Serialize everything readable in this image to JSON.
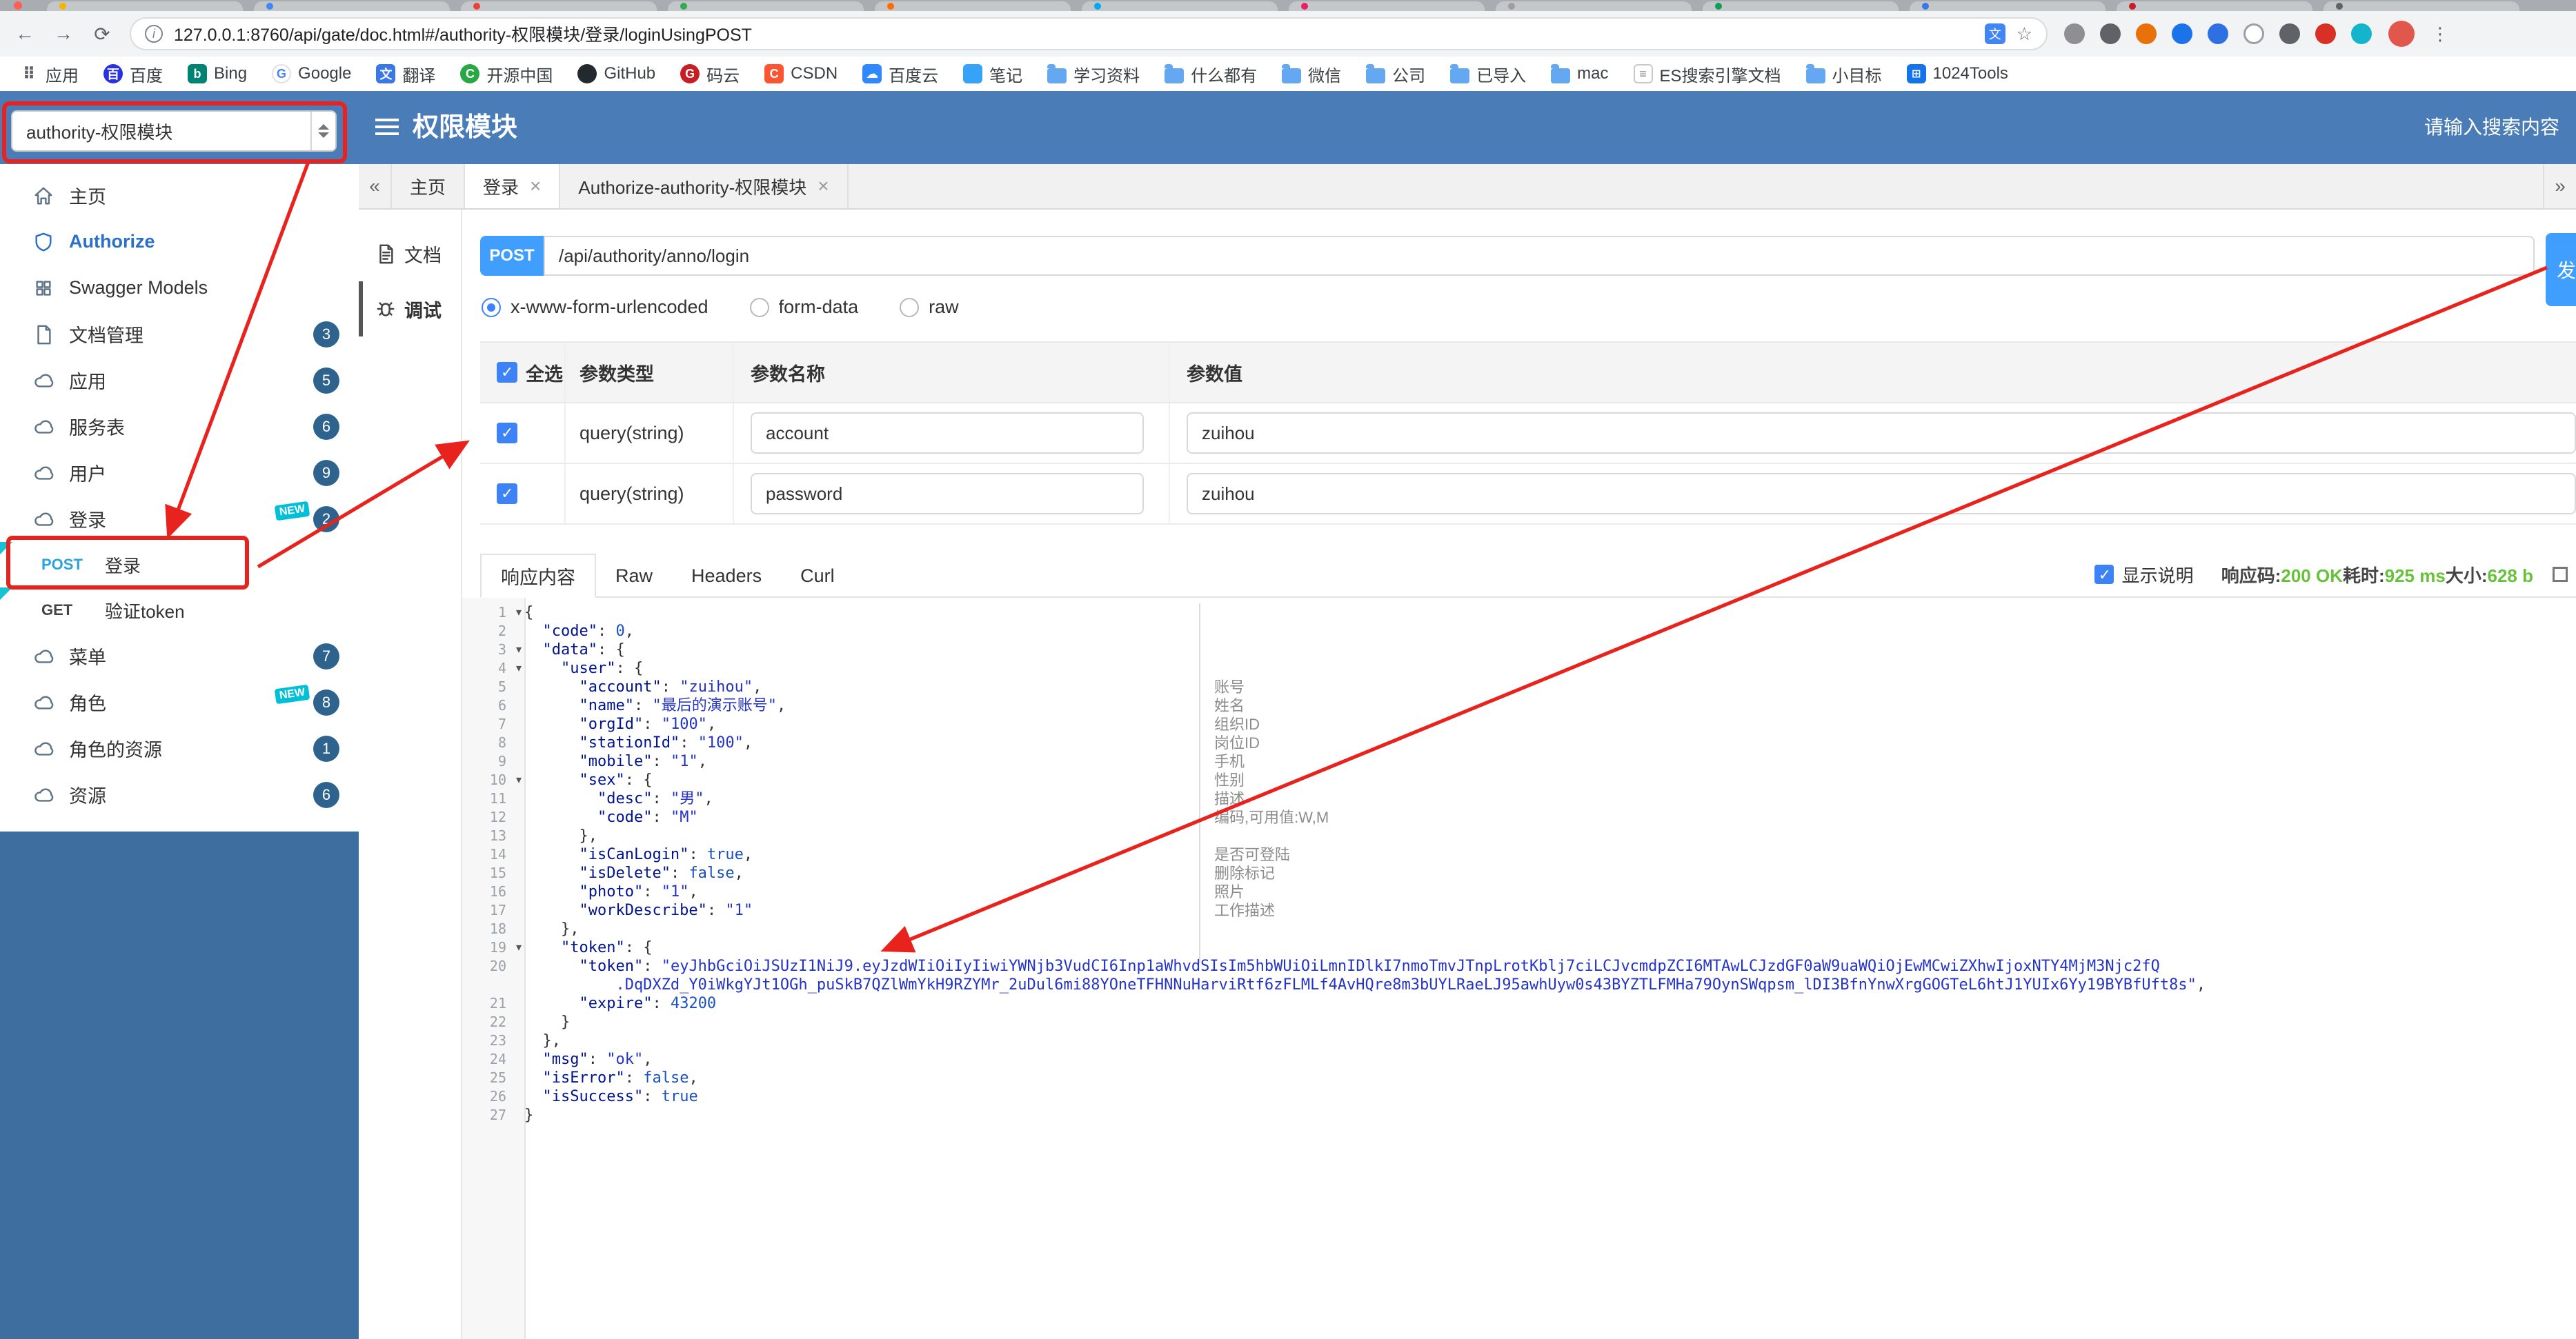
{
  "accent": {
    "primary_blue": "#409EFF",
    "header_blue": "#4a7cb8",
    "sidebar_fill_blue": "#3d6e9f",
    "annotation_red": "#e8231d",
    "badge_blue": "#2e638e",
    "new_teal": "#00c0d8",
    "success_green": "#67c23a"
  },
  "browser": {
    "traffic_light_red": "#ff5f57",
    "tab_favicons": [
      "#f4b400",
      "#4285f4",
      "#ea4335",
      "#34a853",
      "#ff6d00",
      "#03a9f4",
      "#e91e63",
      "#9e9e9e",
      "#0f9d58",
      "#3b78e7",
      "#c71d23",
      "#5f6368"
    ],
    "back_icon": "←",
    "forward_icon": "→",
    "reload_icon": "⟳",
    "info_icon": "i",
    "url": "127.0.0.1:8760/api/gate/doc.html#/authority-权限模块/登录/loginUsingPOST",
    "translate_icon": "文",
    "star_icon": "☆",
    "menu_icon": "⋮",
    "avatar_color": "#e2574c",
    "extensions": [
      {
        "name": "panel-extension-icon",
        "color": "#8e8e93"
      },
      {
        "name": "grid-extension-icon",
        "color": "#5f6368"
      },
      {
        "name": "orange-extension-icon",
        "color": "#e8710a"
      },
      {
        "name": "blue-extension-icon",
        "color": "#1a73e8"
      },
      {
        "name": "json-extension-icon",
        "color": "#2f6fe4"
      },
      {
        "name": "ring-extension-icon",
        "color": "#ffffff"
      },
      {
        "name": "shield-extension-icon",
        "color": "#5f6368"
      },
      {
        "name": "red-extension-icon",
        "color": "#d93025"
      },
      {
        "name": "teal-extension-icon",
        "color": "#12b5cb"
      }
    ],
    "bookmarks": [
      {
        "label": "应用",
        "icon": "apps-grid-icon",
        "glyph": "⠿"
      },
      {
        "label": "百度",
        "icon": "baidu-icon",
        "glyph": "百"
      },
      {
        "label": "Bing",
        "icon": "bing-icon",
        "glyph": "b"
      },
      {
        "label": "Google",
        "icon": "google-icon",
        "glyph": "G"
      },
      {
        "label": "翻译",
        "icon": "translate-bookmark-icon",
        "glyph": "文"
      },
      {
        "label": "开源中国",
        "icon": "oschina-icon",
        "glyph": "C"
      },
      {
        "label": "GitHub",
        "icon": "github-icon",
        "glyph": ""
      },
      {
        "label": "码云",
        "icon": "gitee-icon",
        "glyph": "G"
      },
      {
        "label": "CSDN",
        "icon": "csdn-icon",
        "glyph": "C"
      },
      {
        "label": "百度云",
        "icon": "baidu-cloud-icon",
        "glyph": "☁"
      },
      {
        "label": "笔记",
        "icon": "note-icon",
        "glyph": ""
      },
      {
        "label": "学习资料",
        "icon": "folder-icon",
        "glyph": ""
      },
      {
        "label": "什么都有",
        "icon": "folder-icon",
        "glyph": ""
      },
      {
        "label": "微信",
        "icon": "folder-icon",
        "glyph": ""
      },
      {
        "label": "公司",
        "icon": "folder-icon",
        "glyph": ""
      },
      {
        "label": "已导入",
        "icon": "folder-icon",
        "glyph": ""
      },
      {
        "label": "mac",
        "icon": "folder-icon",
        "glyph": ""
      },
      {
        "label": "ES搜索引擎文档",
        "icon": "doc-icon",
        "glyph": "≡"
      },
      {
        "label": "小目标",
        "icon": "folder-icon",
        "glyph": ""
      },
      {
        "label": "1024Tools",
        "icon": "tools-icon",
        "glyph": "⊞"
      }
    ]
  },
  "header": {
    "module_select_value": "authority-权限模块",
    "title": "权限模块",
    "search_placeholder": "请输入搜索内容"
  },
  "sidebar": {
    "new_label": "NEW",
    "method_colors": {
      "POST": "#29a3dd",
      "GET": "#444444"
    },
    "items": [
      {
        "type": "item",
        "key": "home",
        "icon": "home",
        "label": "主页"
      },
      {
        "type": "item",
        "key": "authorize",
        "icon": "shield",
        "label": "Authorize",
        "accent": true
      },
      {
        "type": "item",
        "key": "swagger-models",
        "icon": "models",
        "label": "Swagger Models"
      },
      {
        "type": "item",
        "key": "doc-manage",
        "icon": "doc",
        "label": "文档管理",
        "badge": "3"
      },
      {
        "type": "item",
        "key": "application",
        "icon": "cloud",
        "label": "应用",
        "badge": "5"
      },
      {
        "type": "item",
        "key": "service-table",
        "icon": "cloud",
        "label": "服务表",
        "badge": "6"
      },
      {
        "type": "item",
        "key": "user",
        "icon": "cloud",
        "label": "用户",
        "badge": "9"
      },
      {
        "type": "item",
        "key": "login-group",
        "icon": "cloud",
        "label": "登录",
        "badge": "2",
        "new": true
      },
      {
        "type": "api",
        "key": "post-login",
        "method": "POST",
        "label": "登录",
        "boxed": true
      },
      {
        "type": "api",
        "key": "get-verify-token",
        "method": "GET",
        "label": "验证token"
      },
      {
        "type": "item",
        "key": "menu",
        "icon": "cloud",
        "label": "菜单",
        "badge": "7"
      },
      {
        "type": "item",
        "key": "role",
        "icon": "cloud",
        "label": "角色",
        "badge": "8",
        "new": true
      },
      {
        "type": "item",
        "key": "role-resource",
        "icon": "cloud",
        "label": "角色的资源",
        "badge": "1"
      },
      {
        "type": "item",
        "key": "resource",
        "icon": "cloud",
        "label": "资源",
        "badge": "6"
      }
    ]
  },
  "doc_tabs": {
    "left_chevron": "«",
    "right_chevron": "»",
    "close_icon": "×",
    "tabs": [
      {
        "key": "home",
        "label": "主页",
        "closable": false,
        "active": false
      },
      {
        "key": "login",
        "label": "登录",
        "closable": true,
        "active": true
      },
      {
        "key": "authorize-authority",
        "label": "Authorize-authority-权限模块",
        "closable": true,
        "active": false
      }
    ]
  },
  "doc_side": {
    "items": [
      {
        "key": "doc",
        "label": "文档",
        "icon": "document",
        "active": false
      },
      {
        "key": "debug",
        "label": "调试",
        "icon": "debug",
        "active": true
      }
    ]
  },
  "request": {
    "method": "POST",
    "url": "/api/authority/anno/login",
    "send_button_visible_text": "发",
    "content_types": [
      {
        "label": "x-www-form-urlencoded",
        "selected": true
      },
      {
        "label": "form-data",
        "selected": false
      },
      {
        "label": "raw",
        "selected": false
      }
    ]
  },
  "params_table": {
    "select_all_label": "全选",
    "headers": [
      "参数类型",
      "参数名称",
      "参数值"
    ],
    "rows": [
      {
        "checked": true,
        "type": "query(string)",
        "name": "account",
        "value": "zuihou"
      },
      {
        "checked": true,
        "type": "query(string)",
        "name": "password",
        "value": "zuihou"
      }
    ]
  },
  "response": {
    "tabs": [
      {
        "label": "响应内容",
        "active": true
      },
      {
        "label": "Raw",
        "active": false
      },
      {
        "label": "Headers",
        "active": false
      },
      {
        "label": "Curl",
        "active": false
      }
    ],
    "show_desc_label": "显示说明",
    "show_desc_checked": true,
    "meta": [
      {
        "label": "响应码:",
        "value": "200 OK"
      },
      {
        "label": "耗时:",
        "value": "925 ms"
      },
      {
        "label": "大小:",
        "value": "628 b"
      }
    ]
  },
  "code": {
    "fold_icon": "▾",
    "lines": [
      {
        "n": 1,
        "fold": true,
        "seg": [
          [
            "p",
            "{"
          ]
        ]
      },
      {
        "n": 2,
        "seg": [
          [
            "p",
            "  "
          ],
          [
            "k",
            "\"code\""
          ],
          [
            "p",
            ": "
          ],
          [
            "n",
            "0"
          ],
          [
            "p",
            ","
          ]
        ]
      },
      {
        "n": 3,
        "fold": true,
        "seg": [
          [
            "p",
            "  "
          ],
          [
            "k",
            "\"data\""
          ],
          [
            "p",
            ": {"
          ]
        ]
      },
      {
        "n": 4,
        "fold": true,
        "seg": [
          [
            "p",
            "    "
          ],
          [
            "k",
            "\"user\""
          ],
          [
            "p",
            ": {"
          ]
        ]
      },
      {
        "n": 5,
        "seg": [
          [
            "p",
            "      "
          ],
          [
            "k",
            "\"account\""
          ],
          [
            "p",
            ": "
          ],
          [
            "s",
            "\"zuihou\""
          ],
          [
            "p",
            ","
          ]
        ]
      },
      {
        "n": 6,
        "seg": [
          [
            "p",
            "      "
          ],
          [
            "k",
            "\"name\""
          ],
          [
            "p",
            ": "
          ],
          [
            "s",
            "\"最后的演示账号\""
          ],
          [
            "p",
            ","
          ]
        ]
      },
      {
        "n": 7,
        "seg": [
          [
            "p",
            "      "
          ],
          [
            "k",
            "\"orgId\""
          ],
          [
            "p",
            ": "
          ],
          [
            "s",
            "\"100\""
          ],
          [
            "p",
            ","
          ]
        ]
      },
      {
        "n": 8,
        "seg": [
          [
            "p",
            "      "
          ],
          [
            "k",
            "\"stationId\""
          ],
          [
            "p",
            ": "
          ],
          [
            "s",
            "\"100\""
          ],
          [
            "p",
            ","
          ]
        ]
      },
      {
        "n": 9,
        "seg": [
          [
            "p",
            "      "
          ],
          [
            "k",
            "\"mobile\""
          ],
          [
            "p",
            ": "
          ],
          [
            "s",
            "\"1\""
          ],
          [
            "p",
            ","
          ]
        ]
      },
      {
        "n": 10,
        "fold": true,
        "seg": [
          [
            "p",
            "      "
          ],
          [
            "k",
            "\"sex\""
          ],
          [
            "p",
            ": {"
          ]
        ]
      },
      {
        "n": 11,
        "seg": [
          [
            "p",
            "        "
          ],
          [
            "k",
            "\"desc\""
          ],
          [
            "p",
            ": "
          ],
          [
            "s",
            "\"男\""
          ],
          [
            "p",
            ","
          ]
        ]
      },
      {
        "n": 12,
        "seg": [
          [
            "p",
            "        "
          ],
          [
            "k",
            "\"code\""
          ],
          [
            "p",
            ": "
          ],
          [
            "s",
            "\"M\""
          ]
        ]
      },
      {
        "n": 13,
        "seg": [
          [
            "p",
            "      },"
          ]
        ]
      },
      {
        "n": 14,
        "seg": [
          [
            "p",
            "      "
          ],
          [
            "k",
            "\"isCanLogin\""
          ],
          [
            "p",
            ": "
          ],
          [
            "b",
            "true"
          ],
          [
            "p",
            ","
          ]
        ]
      },
      {
        "n": 15,
        "seg": [
          [
            "p",
            "      "
          ],
          [
            "k",
            "\"isDelete\""
          ],
          [
            "p",
            ": "
          ],
          [
            "b",
            "false"
          ],
          [
            "p",
            ","
          ]
        ]
      },
      {
        "n": 16,
        "seg": [
          [
            "p",
            "      "
          ],
          [
            "k",
            "\"photo\""
          ],
          [
            "p",
            ": "
          ],
          [
            "s",
            "\"1\""
          ],
          [
            "p",
            ","
          ]
        ]
      },
      {
        "n": 17,
        "seg": [
          [
            "p",
            "      "
          ],
          [
            "k",
            "\"workDescribe\""
          ],
          [
            "p",
            ": "
          ],
          [
            "s",
            "\"1\""
          ]
        ]
      },
      {
        "n": 18,
        "seg": [
          [
            "p",
            "    },"
          ]
        ]
      },
      {
        "n": 19,
        "fold": true,
        "seg": [
          [
            "p",
            "    "
          ],
          [
            "k",
            "\"token\""
          ],
          [
            "p",
            ": {"
          ]
        ]
      },
      {
        "n": 20,
        "seg": [
          [
            "p",
            "      "
          ],
          [
            "k",
            "\"token\""
          ],
          [
            "p",
            ": "
          ],
          [
            "s",
            "\"eyJhbGciOiJSUzI1NiJ9.eyJzdWIiOiIyIiwiYWNjb3VudCI6Inp1aWhvdSIsIm5hbWUiOiLmnIDlkI7nmoTmvJTnpLrotKblj7ciLCJvcmdpZCI6MTAwLCJzdGF0aW9uaWQiOjEwMCwiZXhwIjoxNTY4MjM3Njc2fQ"
          ]
        ],
        "wrap": [
          [
            "s",
            "          .DqDXZd_Y0iWkgYJt1OGh_puSkB7QZlWmYkH9RZYMr_2uDul6mi88YOneTFHNNuHarviRtf6zFLMLf4AvHQre8m3bUYLRaeLJ95awhUyw0s43BYZTLFMHa79OynSWqpsm_lDI3BfnYnwXrgGOGTeL6htJ1YUIx6Yy19BYBfUft8s\""
          ],
          [
            "p",
            ","
          ]
        ]
      },
      {
        "n": 21,
        "seg": [
          [
            "p",
            "      "
          ],
          [
            "k",
            "\"expire\""
          ],
          [
            "p",
            ": "
          ],
          [
            "n",
            "43200"
          ]
        ]
      },
      {
        "n": 22,
        "seg": [
          [
            "p",
            "    }"
          ]
        ]
      },
      {
        "n": 23,
        "seg": [
          [
            "p",
            "  },"
          ]
        ]
      },
      {
        "n": 24,
        "seg": [
          [
            "p",
            "  "
          ],
          [
            "k",
            "\"msg\""
          ],
          [
            "p",
            ": "
          ],
          [
            "s",
            "\"ok\""
          ],
          [
            "p",
            ","
          ]
        ]
      },
      {
        "n": 25,
        "seg": [
          [
            "p",
            "  "
          ],
          [
            "k",
            "\"isError\""
          ],
          [
            "p",
            ": "
          ],
          [
            "b",
            "false"
          ],
          [
            "p",
            ","
          ]
        ]
      },
      {
        "n": 26,
        "seg": [
          [
            "p",
            "  "
          ],
          [
            "k",
            "\"isSuccess\""
          ],
          [
            "p",
            ": "
          ],
          [
            "b",
            "true"
          ]
        ]
      },
      {
        "n": 27,
        "seg": [
          [
            "p",
            "}"
          ]
        ]
      }
    ],
    "field_notes": [
      {
        "line": 5,
        "text": "账号"
      },
      {
        "line": 6,
        "text": "姓名"
      },
      {
        "line": 7,
        "text": "组织ID"
      },
      {
        "line": 8,
        "text": "岗位ID"
      },
      {
        "line": 9,
        "text": "手机"
      },
      {
        "line": 10,
        "text": "性别"
      },
      {
        "line": 11,
        "text": "描述"
      },
      {
        "line": 12,
        "text": "编码,可用值:W,M"
      },
      {
        "line": 14,
        "text": "是否可登陆"
      },
      {
        "line": 15,
        "text": "删除标记"
      },
      {
        "line": 16,
        "text": "照片"
      },
      {
        "line": 17,
        "text": "工作描述"
      }
    ]
  }
}
